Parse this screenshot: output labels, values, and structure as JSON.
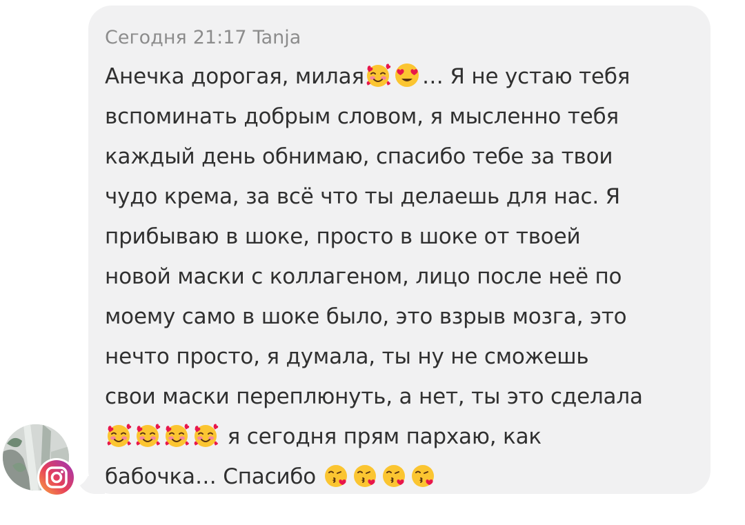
{
  "message": {
    "date_label": "Сегодня",
    "time": "21:17",
    "sender": "Tanja",
    "lines": [
      "Анечка дорогая, милая",
      "… Я не устаю тебя",
      "вспоминать добрым словом, я мысленно тебя",
      "каждый день обнимаю, спасибо тебе за твои",
      "чудо крема, за всё что ты делаешь для нас. Я",
      "прибываю в шоке, просто в шоке от твоей",
      "новой маски с коллагеном, лицо после неё по",
      "моему само в шоке было, это взрыв мозга, это",
      "нечто просто, я думала, ты ну не сможешь",
      "свои маски переплюнуть, а нет, ты это сделала",
      "я сегодня прям пархаю, как",
      "бабочка… Спасибо"
    ]
  },
  "icons": {
    "smiling_face_with_hearts": "smiling-face-with-hearts-icon",
    "heart_eyes": "heart-eyes-icon",
    "kissing_heart": "kissing-heart-icon",
    "instagram": "instagram-icon"
  },
  "colors": {
    "bubble": "#f1f1f2",
    "text": "#303030",
    "meta": "#8c8c8c"
  }
}
